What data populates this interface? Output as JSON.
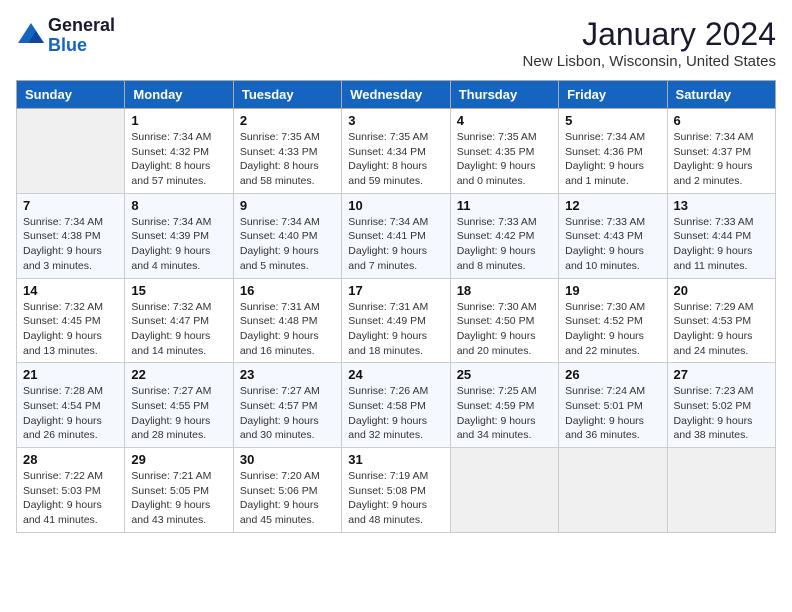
{
  "header": {
    "logo_general": "General",
    "logo_blue": "Blue",
    "month_title": "January 2024",
    "location": "New Lisbon, Wisconsin, United States"
  },
  "days_of_week": [
    "Sunday",
    "Monday",
    "Tuesday",
    "Wednesday",
    "Thursday",
    "Friday",
    "Saturday"
  ],
  "weeks": [
    [
      {
        "day": "",
        "info": ""
      },
      {
        "day": "1",
        "info": "Sunrise: 7:34 AM\nSunset: 4:32 PM\nDaylight: 8 hours\nand 57 minutes."
      },
      {
        "day": "2",
        "info": "Sunrise: 7:35 AM\nSunset: 4:33 PM\nDaylight: 8 hours\nand 58 minutes."
      },
      {
        "day": "3",
        "info": "Sunrise: 7:35 AM\nSunset: 4:34 PM\nDaylight: 8 hours\nand 59 minutes."
      },
      {
        "day": "4",
        "info": "Sunrise: 7:35 AM\nSunset: 4:35 PM\nDaylight: 9 hours\nand 0 minutes."
      },
      {
        "day": "5",
        "info": "Sunrise: 7:34 AM\nSunset: 4:36 PM\nDaylight: 9 hours\nand 1 minute."
      },
      {
        "day": "6",
        "info": "Sunrise: 7:34 AM\nSunset: 4:37 PM\nDaylight: 9 hours\nand 2 minutes."
      }
    ],
    [
      {
        "day": "7",
        "info": "Sunrise: 7:34 AM\nSunset: 4:38 PM\nDaylight: 9 hours\nand 3 minutes."
      },
      {
        "day": "8",
        "info": "Sunrise: 7:34 AM\nSunset: 4:39 PM\nDaylight: 9 hours\nand 4 minutes."
      },
      {
        "day": "9",
        "info": "Sunrise: 7:34 AM\nSunset: 4:40 PM\nDaylight: 9 hours\nand 5 minutes."
      },
      {
        "day": "10",
        "info": "Sunrise: 7:34 AM\nSunset: 4:41 PM\nDaylight: 9 hours\nand 7 minutes."
      },
      {
        "day": "11",
        "info": "Sunrise: 7:33 AM\nSunset: 4:42 PM\nDaylight: 9 hours\nand 8 minutes."
      },
      {
        "day": "12",
        "info": "Sunrise: 7:33 AM\nSunset: 4:43 PM\nDaylight: 9 hours\nand 10 minutes."
      },
      {
        "day": "13",
        "info": "Sunrise: 7:33 AM\nSunset: 4:44 PM\nDaylight: 9 hours\nand 11 minutes."
      }
    ],
    [
      {
        "day": "14",
        "info": "Sunrise: 7:32 AM\nSunset: 4:45 PM\nDaylight: 9 hours\nand 13 minutes."
      },
      {
        "day": "15",
        "info": "Sunrise: 7:32 AM\nSunset: 4:47 PM\nDaylight: 9 hours\nand 14 minutes."
      },
      {
        "day": "16",
        "info": "Sunrise: 7:31 AM\nSunset: 4:48 PM\nDaylight: 9 hours\nand 16 minutes."
      },
      {
        "day": "17",
        "info": "Sunrise: 7:31 AM\nSunset: 4:49 PM\nDaylight: 9 hours\nand 18 minutes."
      },
      {
        "day": "18",
        "info": "Sunrise: 7:30 AM\nSunset: 4:50 PM\nDaylight: 9 hours\nand 20 minutes."
      },
      {
        "day": "19",
        "info": "Sunrise: 7:30 AM\nSunset: 4:52 PM\nDaylight: 9 hours\nand 22 minutes."
      },
      {
        "day": "20",
        "info": "Sunrise: 7:29 AM\nSunset: 4:53 PM\nDaylight: 9 hours\nand 24 minutes."
      }
    ],
    [
      {
        "day": "21",
        "info": "Sunrise: 7:28 AM\nSunset: 4:54 PM\nDaylight: 9 hours\nand 26 minutes."
      },
      {
        "day": "22",
        "info": "Sunrise: 7:27 AM\nSunset: 4:55 PM\nDaylight: 9 hours\nand 28 minutes."
      },
      {
        "day": "23",
        "info": "Sunrise: 7:27 AM\nSunset: 4:57 PM\nDaylight: 9 hours\nand 30 minutes."
      },
      {
        "day": "24",
        "info": "Sunrise: 7:26 AM\nSunset: 4:58 PM\nDaylight: 9 hours\nand 32 minutes."
      },
      {
        "day": "25",
        "info": "Sunrise: 7:25 AM\nSunset: 4:59 PM\nDaylight: 9 hours\nand 34 minutes."
      },
      {
        "day": "26",
        "info": "Sunrise: 7:24 AM\nSunset: 5:01 PM\nDaylight: 9 hours\nand 36 minutes."
      },
      {
        "day": "27",
        "info": "Sunrise: 7:23 AM\nSunset: 5:02 PM\nDaylight: 9 hours\nand 38 minutes."
      }
    ],
    [
      {
        "day": "28",
        "info": "Sunrise: 7:22 AM\nSunset: 5:03 PM\nDaylight: 9 hours\nand 41 minutes."
      },
      {
        "day": "29",
        "info": "Sunrise: 7:21 AM\nSunset: 5:05 PM\nDaylight: 9 hours\nand 43 minutes."
      },
      {
        "day": "30",
        "info": "Sunrise: 7:20 AM\nSunset: 5:06 PM\nDaylight: 9 hours\nand 45 minutes."
      },
      {
        "day": "31",
        "info": "Sunrise: 7:19 AM\nSunset: 5:08 PM\nDaylight: 9 hours\nand 48 minutes."
      },
      {
        "day": "",
        "info": ""
      },
      {
        "day": "",
        "info": ""
      },
      {
        "day": "",
        "info": ""
      }
    ]
  ]
}
